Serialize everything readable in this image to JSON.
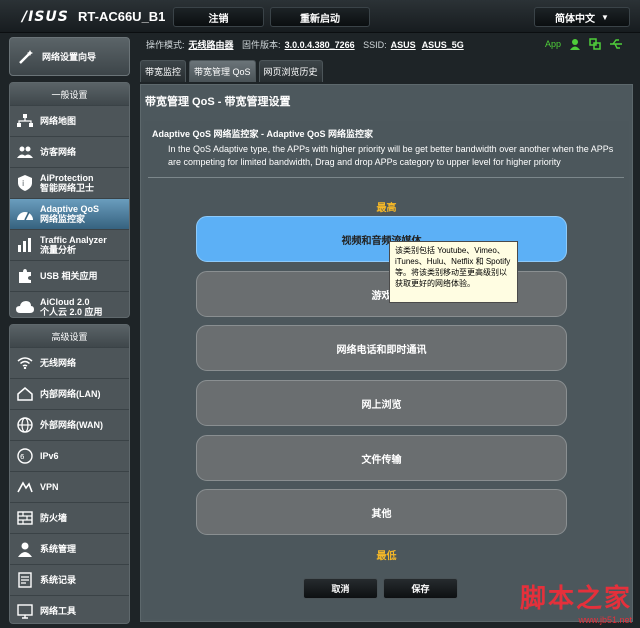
{
  "header": {
    "logo": "/ISUS",
    "model": "RT-AC66U_B1",
    "logout": "注销",
    "reboot": "重新启动",
    "language": "简体中文"
  },
  "status": {
    "mode_label": "操作模式:",
    "mode_value": "无线路由器",
    "fw_label": "固件版本:",
    "fw_value": "3.0.0.4.380_7266",
    "ssid_label": "SSID:",
    "ssid_1": "ASUS",
    "ssid_2": "ASUS_5G",
    "app_label": "App"
  },
  "sidebar": {
    "wizard": "网络设置向导",
    "general_head": "一般设置",
    "general_items": [
      {
        "label": "网络地图",
        "icon": "network-map-icon"
      },
      {
        "label": "访客网络",
        "icon": "guest-network-icon"
      },
      {
        "label": "AiProtection",
        "label2": "智能网络卫士",
        "icon": "shield-icon"
      },
      {
        "label": "Adaptive QoS",
        "label2": "网络监控家",
        "icon": "qos-icon"
      },
      {
        "label": "Traffic Analyzer",
        "label2": "流量分析",
        "icon": "traffic-icon"
      },
      {
        "label": "USB 相关应用",
        "icon": "puzzle-icon"
      },
      {
        "label": "AiCloud 2.0",
        "label2": "个人云 2.0 应用",
        "icon": "cloud-icon"
      }
    ],
    "advanced_head": "高级设置",
    "advanced_items": [
      {
        "label": "无线网络",
        "icon": "wireless-icon"
      },
      {
        "label": "内部网络(LAN)",
        "icon": "lan-icon"
      },
      {
        "label": "外部网络(WAN)",
        "icon": "wan-icon"
      },
      {
        "label": "IPv6",
        "icon": "ipv6-icon"
      },
      {
        "label": "VPN",
        "icon": "vpn-icon"
      },
      {
        "label": "防火墙",
        "icon": "firewall-icon"
      },
      {
        "label": "系统管理",
        "icon": "admin-icon"
      },
      {
        "label": "系统记录",
        "icon": "log-icon"
      },
      {
        "label": "网络工具",
        "icon": "tools-icon"
      }
    ]
  },
  "tabs": [
    "带宽监控",
    "带宽管理 QoS",
    "网页浏览历史"
  ],
  "panel": {
    "title": "带宽管理 QoS - 带宽管理设置",
    "subtitle": "Adaptive QoS 网络监控家 - Adaptive QoS 网络监控家",
    "description": "In the QoS Adaptive type, the APPs with higher priority will be get better bandwidth over another when the APPs are competing for limited bandwidth, Drag and drop APPs category to upper level for higher priority",
    "highest": "最高",
    "lowest": "最低",
    "categories": [
      "视频和音频流媒体",
      "游戏",
      "网络电话和即时通讯",
      "网上浏览",
      "文件传输",
      "其他"
    ],
    "tooltip": "该类别包括 Youtube、Vimeo、iTunes、Hulu、Netflix 和 Spotify 等。将该类别移动至更高级别以获取更好的网络体验。",
    "cancel": "取消",
    "save": "保存"
  },
  "watermark": {
    "big": "脚本之家",
    "small": "www.jb51.net"
  },
  "colors": {
    "accent": "#5cb0f6",
    "priority": "#f6b827",
    "watermark": "#e5303b"
  }
}
